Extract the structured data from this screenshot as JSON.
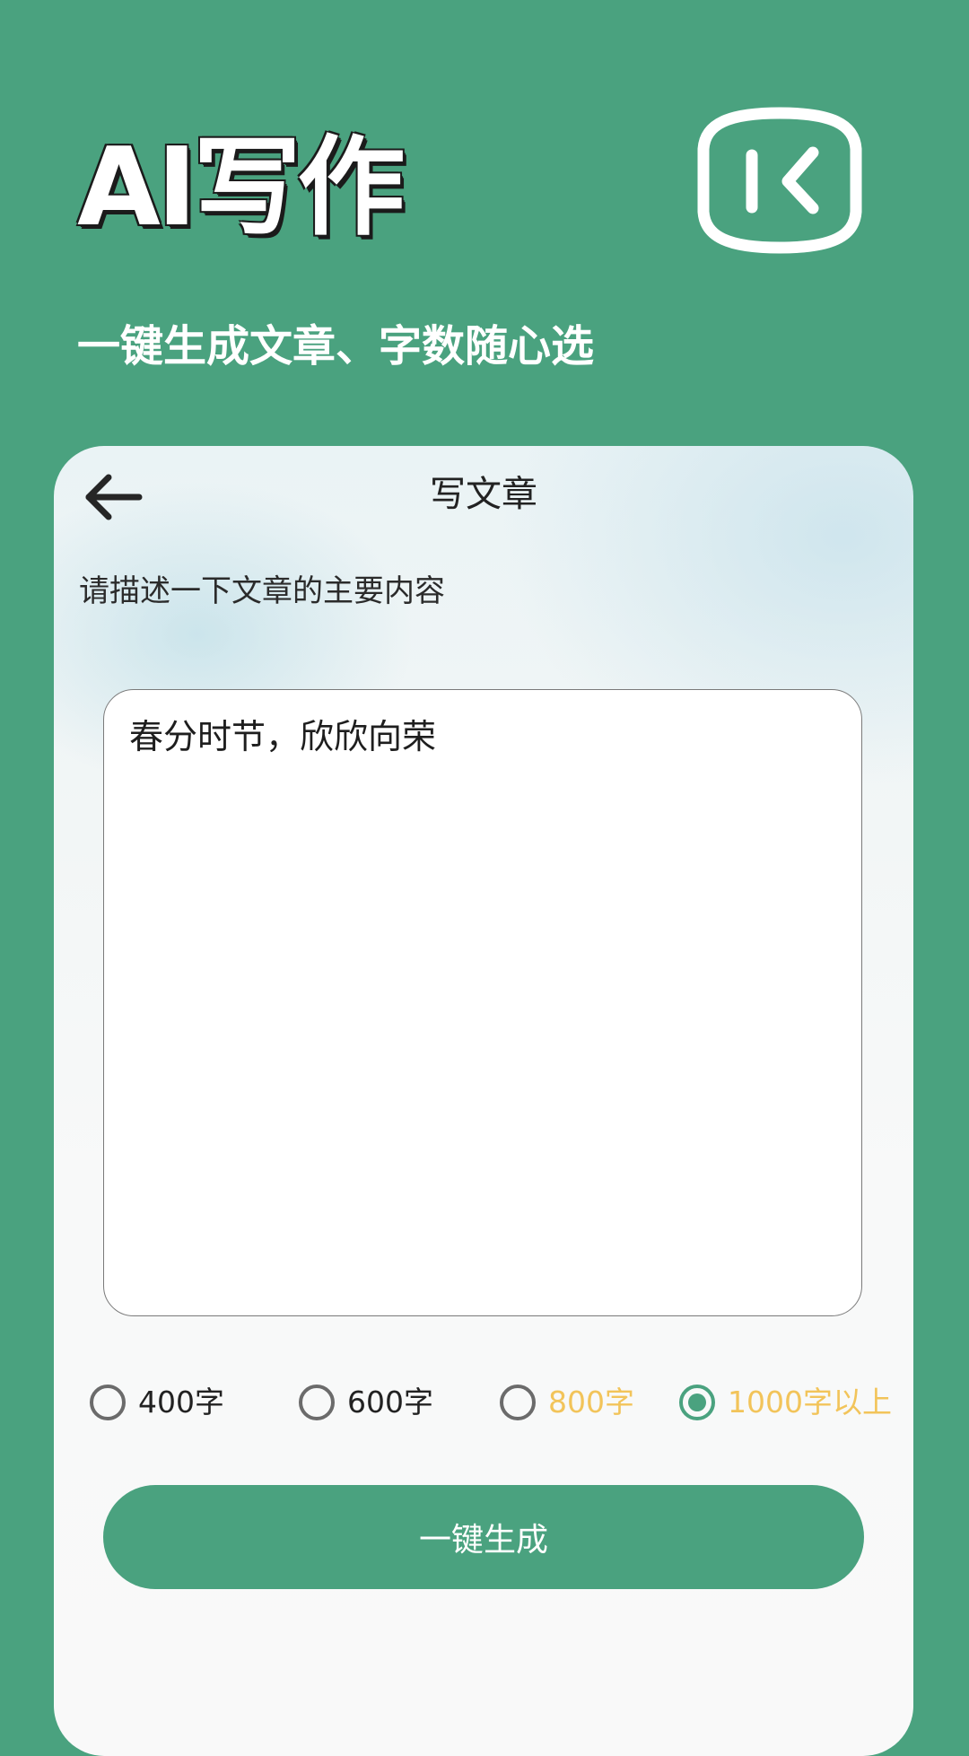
{
  "hero": {
    "title": "AI写作",
    "subtitle": "一键生成文章、字数随心选",
    "logo_icon": "back-frame-icon"
  },
  "card": {
    "title": "写文章",
    "back_icon": "arrow-left-icon",
    "prompt_label": "请描述一下文章的主要内容",
    "input_value": "春分时节，欣欣向荣"
  },
  "word_count_options": [
    {
      "label": "400字",
      "selected": false,
      "highlighted": false
    },
    {
      "label": "600字",
      "selected": false,
      "highlighted": false
    },
    {
      "label": "800字",
      "selected": false,
      "highlighted": true
    },
    {
      "label": "1000字以上",
      "selected": true,
      "highlighted": true
    }
  ],
  "generate_button": {
    "label": "一键生成"
  },
  "colors": {
    "primary": "#4aa27f",
    "highlight": "#f2c45a",
    "text": "#222222"
  }
}
